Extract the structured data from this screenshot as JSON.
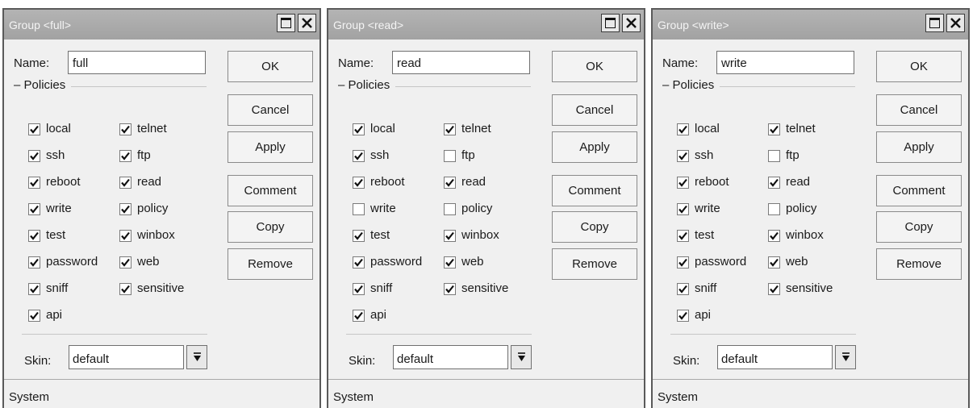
{
  "dialogs": [
    {
      "title": "Group <full>",
      "name_label": "Name:",
      "name_value": "full",
      "policies_label": "Policies",
      "policies": [
        {
          "label": "local",
          "checked": true
        },
        {
          "label": "ssh",
          "checked": true
        },
        {
          "label": "reboot",
          "checked": true
        },
        {
          "label": "write",
          "checked": true
        },
        {
          "label": "test",
          "checked": true
        },
        {
          "label": "password",
          "checked": true
        },
        {
          "label": "sniff",
          "checked": true
        },
        {
          "label": "api",
          "checked": true
        },
        {
          "label": "telnet",
          "checked": true
        },
        {
          "label": "ftp",
          "checked": true
        },
        {
          "label": "read",
          "checked": true
        },
        {
          "label": "policy",
          "checked": true
        },
        {
          "label": "winbox",
          "checked": true
        },
        {
          "label": "web",
          "checked": true
        },
        {
          "label": "sensitive",
          "checked": true
        }
      ],
      "skin_label": "Skin:",
      "skin_value": "default",
      "status": "System",
      "buttons": {
        "ok": "OK",
        "cancel": "Cancel",
        "apply": "Apply",
        "comment": "Comment",
        "copy": "Copy",
        "remove": "Remove"
      }
    },
    {
      "title": "Group <read>",
      "name_label": "Name:",
      "name_value": "read",
      "policies_label": "Policies",
      "policies": [
        {
          "label": "local",
          "checked": true
        },
        {
          "label": "ssh",
          "checked": true
        },
        {
          "label": "reboot",
          "checked": true
        },
        {
          "label": "write",
          "checked": false
        },
        {
          "label": "test",
          "checked": true
        },
        {
          "label": "password",
          "checked": true
        },
        {
          "label": "sniff",
          "checked": true
        },
        {
          "label": "api",
          "checked": true
        },
        {
          "label": "telnet",
          "checked": true
        },
        {
          "label": "ftp",
          "checked": false
        },
        {
          "label": "read",
          "checked": true
        },
        {
          "label": "policy",
          "checked": false
        },
        {
          "label": "winbox",
          "checked": true
        },
        {
          "label": "web",
          "checked": true
        },
        {
          "label": "sensitive",
          "checked": true
        }
      ],
      "skin_label": "Skin:",
      "skin_value": "default",
      "status": "System",
      "buttons": {
        "ok": "OK",
        "cancel": "Cancel",
        "apply": "Apply",
        "comment": "Comment",
        "copy": "Copy",
        "remove": "Remove"
      }
    },
    {
      "title": "Group <write>",
      "name_label": "Name:",
      "name_value": "write",
      "policies_label": "Policies",
      "policies": [
        {
          "label": "local",
          "checked": true
        },
        {
          "label": "ssh",
          "checked": true
        },
        {
          "label": "reboot",
          "checked": true
        },
        {
          "label": "write",
          "checked": true
        },
        {
          "label": "test",
          "checked": true
        },
        {
          "label": "password",
          "checked": true
        },
        {
          "label": "sniff",
          "checked": true
        },
        {
          "label": "api",
          "checked": true
        },
        {
          "label": "telnet",
          "checked": true
        },
        {
          "label": "ftp",
          "checked": false
        },
        {
          "label": "read",
          "checked": true
        },
        {
          "label": "policy",
          "checked": false
        },
        {
          "label": "winbox",
          "checked": true
        },
        {
          "label": "web",
          "checked": true
        },
        {
          "label": "sensitive",
          "checked": true
        }
      ],
      "skin_label": "Skin:",
      "skin_value": "default",
      "status": "System",
      "buttons": {
        "ok": "OK",
        "cancel": "Cancel",
        "apply": "Apply",
        "comment": "Comment",
        "copy": "Copy",
        "remove": "Remove"
      }
    }
  ]
}
